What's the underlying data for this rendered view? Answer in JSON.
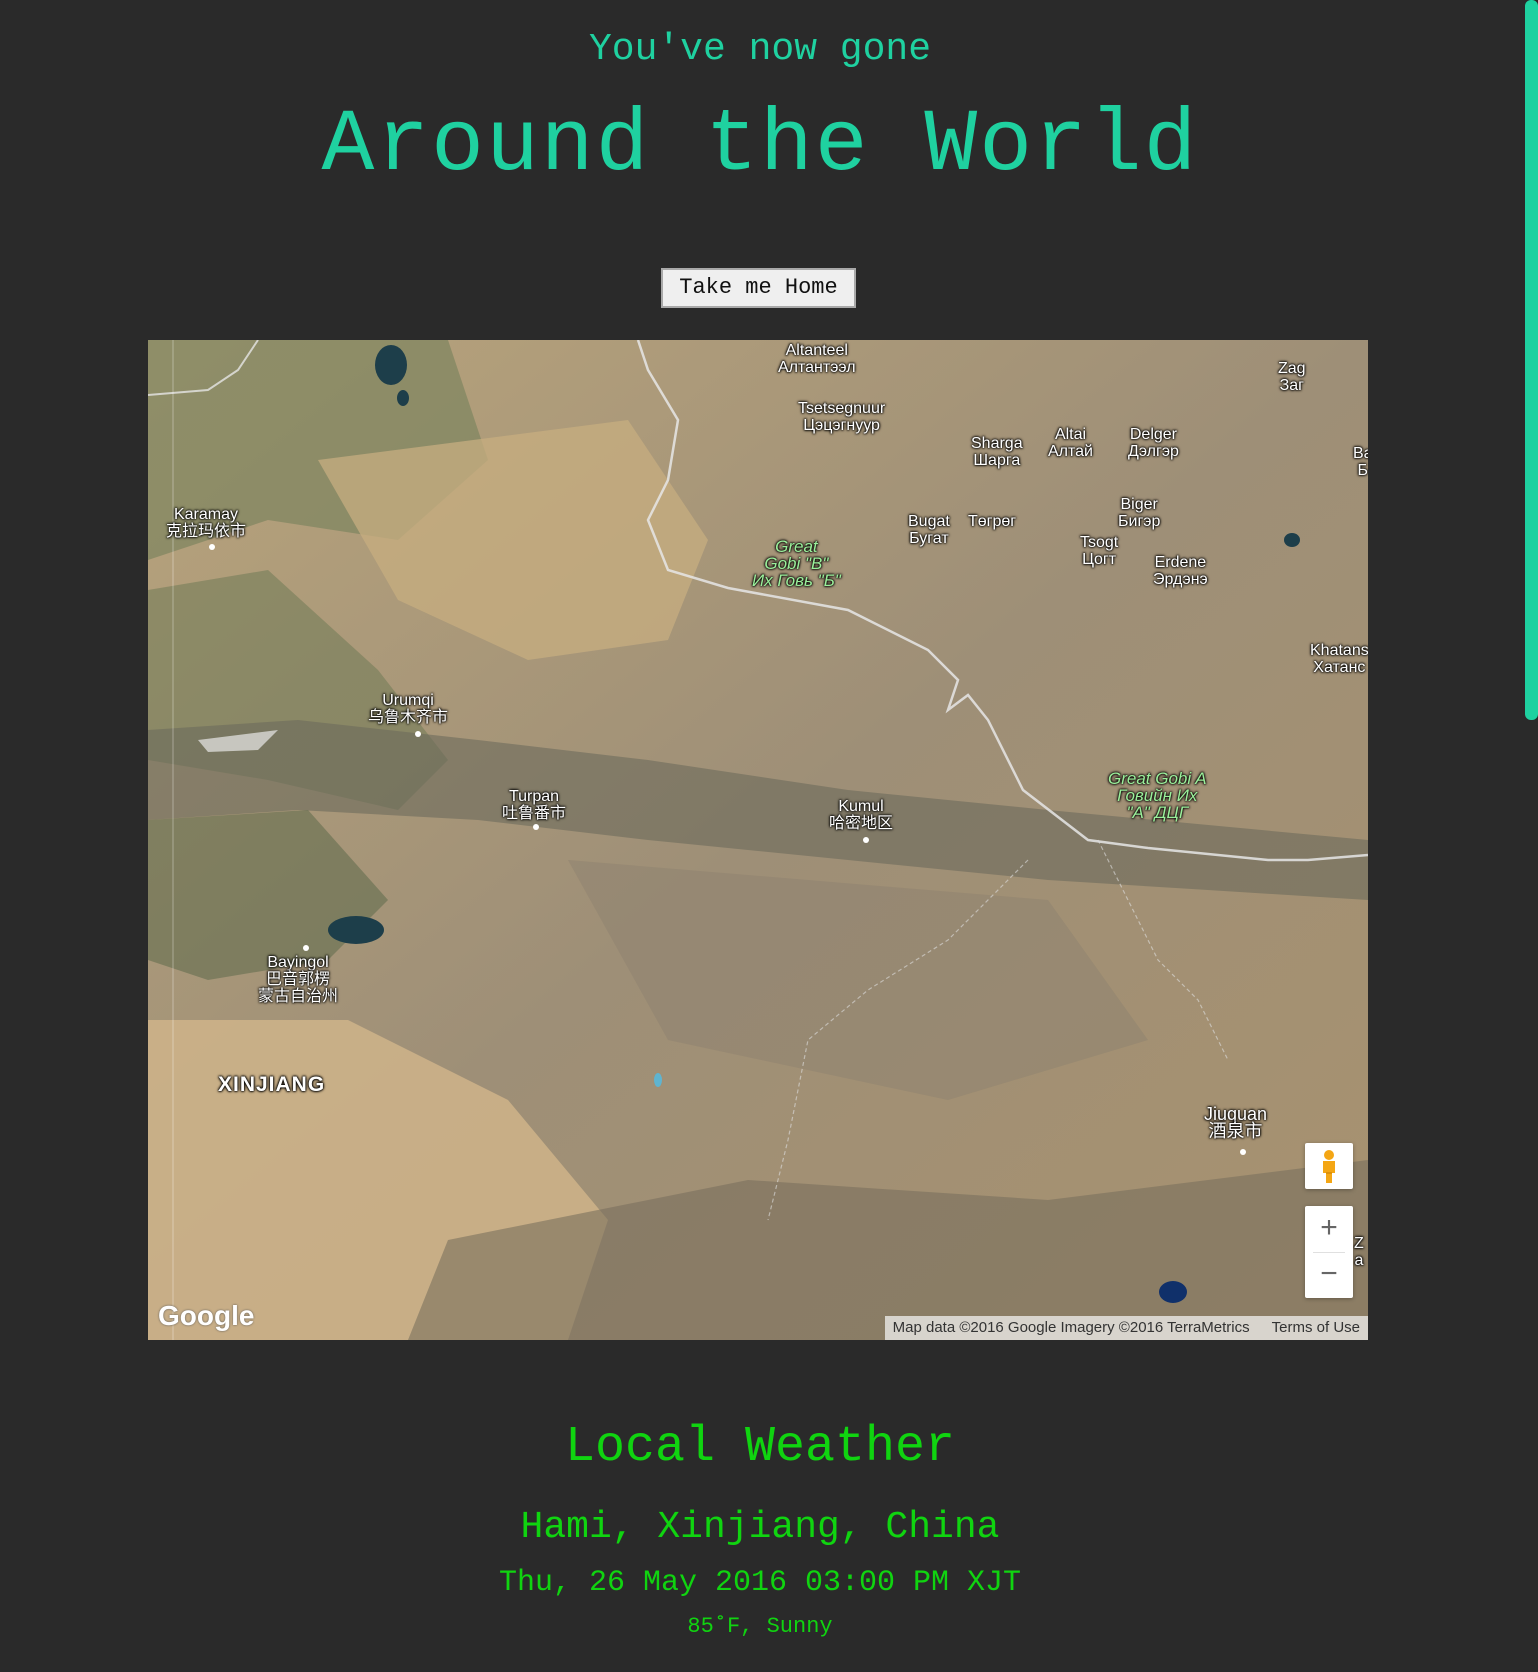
{
  "header": {
    "subtitle": "You've now gone",
    "title": "Around the World"
  },
  "home_button": {
    "label": "Take me Home"
  },
  "map": {
    "provider_logo": "Google",
    "attribution": "Map data ©2016 Google Imagery ©2016 TerraMetrics",
    "terms_link": "Terms of Use",
    "zoom_in": "+",
    "zoom_out": "−",
    "pegman_icon": "street-view-pegman-icon",
    "labels": {
      "altanteel": [
        "Altanteel",
        "Алтантээл"
      ],
      "tsetsegnuur": [
        "Tsetsegnuur",
        "Цэцэгнуур"
      ],
      "sharga": [
        "Sharga",
        "Шарга"
      ],
      "altai": [
        "Altai",
        "Алтай"
      ],
      "delger": [
        "Delger",
        "Дэлгэр"
      ],
      "zag": [
        "Zag",
        "Заг"
      ],
      "karamay": [
        "Karamay",
        "克拉玛依市"
      ],
      "bugat": [
        "Bugat",
        "Бугат"
      ],
      "togrog": [
        "Төгрөг"
      ],
      "biger": [
        "Biger",
        "Бигэр"
      ],
      "tsogt": [
        "Tsogt",
        "Цогт"
      ],
      "erdene": [
        "Erdene",
        "Эрдэнэ"
      ],
      "great_gobi_b": [
        "Great",
        "Gobi \"B\"",
        "Их Говь \"Б\""
      ],
      "khatans": [
        "Khatans",
        "Хатанс"
      ],
      "urumqi": [
        "Urumqi",
        "乌鲁木齐市"
      ],
      "turpan": [
        "Turpan",
        "吐鲁番市"
      ],
      "kumul": [
        "Kumul",
        "哈密地区"
      ],
      "great_gobi_a": [
        "Great Gobi A",
        "Говийн Их",
        "\"А\" ДЦГ"
      ],
      "bayingol": [
        "Bayingol",
        "巴音郭楞",
        "蒙古自治州"
      ],
      "xinjiang": [
        "XINJIANG"
      ],
      "jiuquan": [
        "Jiuquan",
        "酒泉市"
      ],
      "edge_b": [
        "Ba",
        "Б"
      ],
      "edge_z": [
        "Z",
        "a"
      ]
    }
  },
  "weather": {
    "heading": "Local Weather",
    "location": "Hami, Xinjiang, China",
    "datetime": "Thu, 26 May 2016 03:00 PM XJT",
    "conditions": "85˚F, Sunny"
  }
}
